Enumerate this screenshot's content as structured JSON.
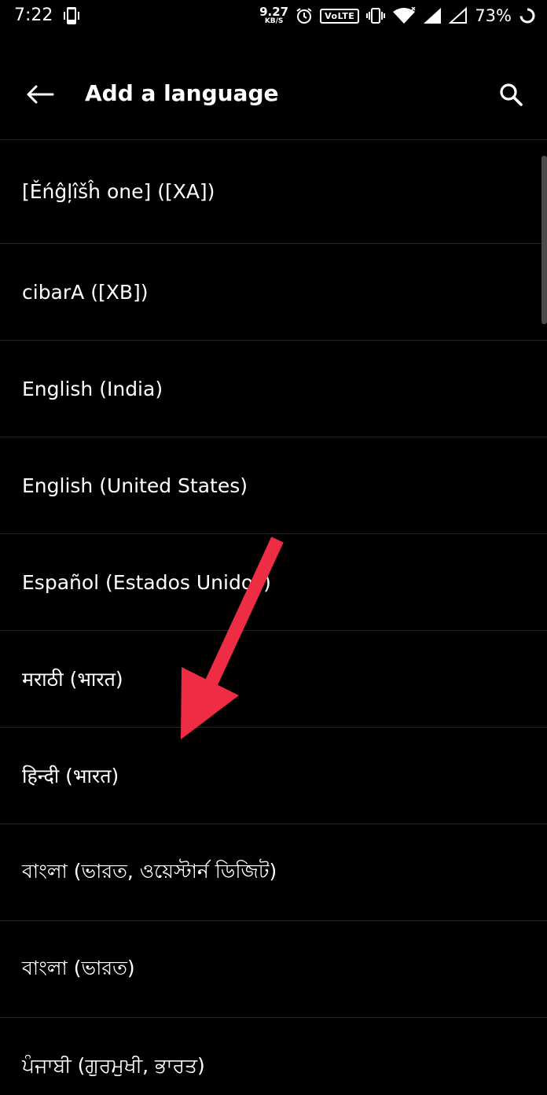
{
  "status_bar": {
    "time": "7:22",
    "net_speed_value": "9.27",
    "net_speed_unit": "KB/S",
    "volte_label": "VoLTE",
    "battery_percent": "73%"
  },
  "app_bar": {
    "title": "Add a language",
    "back_icon": "arrow-back-icon",
    "search_icon": "search-icon"
  },
  "languages": [
    "[Ěńĝļîšĥ one] ([XA])",
    "cibarA ([XB])",
    "English (India)",
    "English (United States)",
    "Español (Estados Unidos)",
    "मराठी (भारत)",
    "हिन्दी (भारत)",
    "বাংলা (ভারত, ওয়েস্টার্ন ডিজিট)",
    "বাংলা (ভারত)",
    "ਪੰਜਾਬੀ (ਗੁਰਮੁਖੀ, ਭਾਰਤ)"
  ],
  "colors": {
    "background": "#000000",
    "text": "#ffffff",
    "divider": "#262626",
    "annotation_arrow": "#ee2d45"
  }
}
